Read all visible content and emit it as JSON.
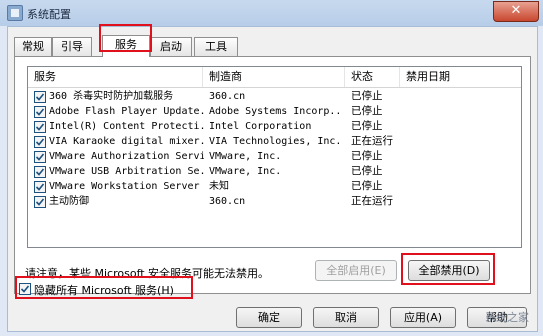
{
  "window": {
    "title": "系统配置",
    "close_glyph": "✕"
  },
  "tabs": [
    {
      "label": "常规"
    },
    {
      "label": "引导"
    },
    {
      "label": "服务",
      "active": true
    },
    {
      "label": "启动"
    },
    {
      "label": "工具"
    }
  ],
  "services": {
    "columns": [
      "服务",
      "制造商",
      "状态",
      "禁用日期"
    ],
    "rows": [
      {
        "name": "360 杀毒实时防护加载服务",
        "maker": "360.cn",
        "status": "已停止",
        "checked": true
      },
      {
        "name": "Adobe Flash Player Update...",
        "maker": "Adobe Systems Incorp...",
        "status": "已停止",
        "checked": true
      },
      {
        "name": "Intel(R) Content Protecti...",
        "maker": "Intel Corporation",
        "status": "已停止",
        "checked": true
      },
      {
        "name": "VIA Karaoke digital mixer...",
        "maker": "VIA Technologies, Inc.",
        "status": "正在运行",
        "checked": true
      },
      {
        "name": "VMware Authorization Service",
        "maker": "VMware, Inc.",
        "status": "已停止",
        "checked": true
      },
      {
        "name": "VMware USB Arbitration Se...",
        "maker": "VMware, Inc.",
        "status": "已停止",
        "checked": true
      },
      {
        "name": "VMware Workstation Server",
        "maker": "未知",
        "status": "已停止",
        "checked": true
      },
      {
        "name": "主动防御",
        "maker": "360.cn",
        "status": "正在运行",
        "checked": true
      }
    ]
  },
  "note": "请注意，某些 Microsoft 安全服务可能无法禁用。",
  "buttons": {
    "enable_all": "全部启用(E)",
    "disable_all": "全部禁用(D)",
    "ok": "确定",
    "cancel": "取消",
    "apply": "应用(A)",
    "help": "帮助"
  },
  "hide_ms": {
    "label": "隐藏所有 Microsoft 服务(H)",
    "checked": true
  },
  "watermark": "系统之家",
  "colors": {
    "highlight": "#e0101d",
    "accent": "#1c5180"
  }
}
